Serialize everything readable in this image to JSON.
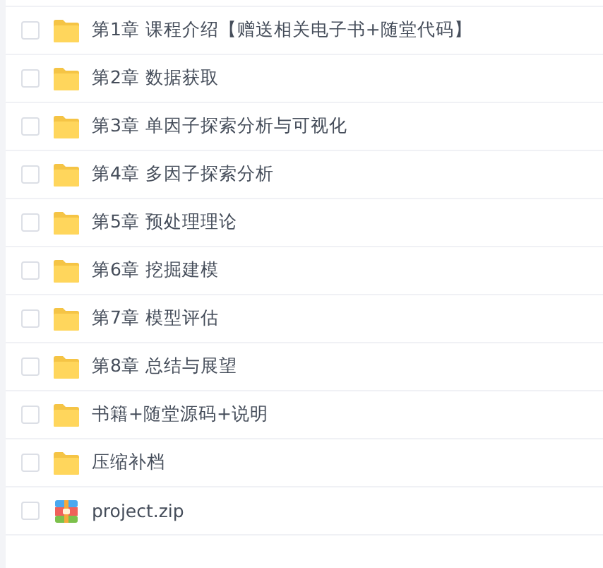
{
  "files": [
    {
      "name": "第1章 课程介绍【赠送相关电子书+随堂代码】",
      "kind": "folder",
      "checked": false
    },
    {
      "name": "第2章 数据获取",
      "kind": "folder",
      "checked": false
    },
    {
      "name": "第3章 单因子探索分析与可视化",
      "kind": "folder",
      "checked": false
    },
    {
      "name": "第4章 多因子探索分析",
      "kind": "folder",
      "checked": false
    },
    {
      "name": "第5章 预处理理论",
      "kind": "folder",
      "checked": false
    },
    {
      "name": "第6章 挖掘建模",
      "kind": "folder",
      "checked": false
    },
    {
      "name": "第7章 模型评估",
      "kind": "folder",
      "checked": false
    },
    {
      "name": "第8章 总结与展望",
      "kind": "folder",
      "checked": false
    },
    {
      "name": "书籍+随堂源码+说明",
      "kind": "folder",
      "checked": false
    },
    {
      "name": "压缩补档",
      "kind": "folder",
      "checked": false
    },
    {
      "name": "project.zip",
      "kind": "zip",
      "checked": false
    }
  ]
}
